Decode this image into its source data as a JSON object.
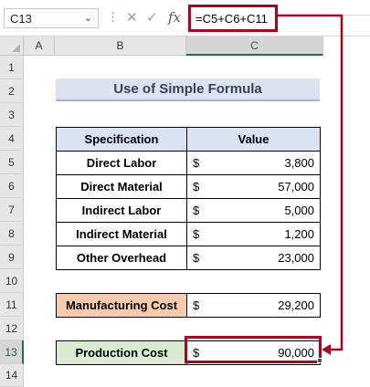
{
  "formula_bar": {
    "name_box": "C13",
    "formula": "=C5+C6+C11",
    "cancel_icon": "x-icon",
    "enter_icon": "check-icon",
    "function_icon": "fx"
  },
  "columns": [
    "A",
    "B",
    "C"
  ],
  "rows": [
    "1",
    "2",
    "3",
    "4",
    "5",
    "6",
    "7",
    "8",
    "9",
    "10",
    "11",
    "12",
    "13",
    "14"
  ],
  "title": "Use of Simple Formula",
  "table": {
    "header_spec": "Specification",
    "header_value": "Value",
    "rows": [
      {
        "label": "Direct Labor",
        "currency": "$",
        "value": "3,800"
      },
      {
        "label": "Direct Material",
        "currency": "$",
        "value": "57,000"
      },
      {
        "label": "Indirect Labor",
        "currency": "$",
        "value": "5,000"
      },
      {
        "label": "Indirect Material",
        "currency": "$",
        "value": "1,200"
      },
      {
        "label": "Other Overhead",
        "currency": "$",
        "value": "23,000"
      }
    ]
  },
  "manufacturing": {
    "label": "Manufacturing Cost",
    "currency": "$",
    "value": "29,200"
  },
  "production": {
    "label": "Production Cost",
    "currency": "$",
    "value": "90,000"
  },
  "colors": {
    "highlight_red": "#b00020",
    "title_fill": "#dbe3f1",
    "header_fill": "#d9e3f3",
    "manufacturing_fill": "#f8cbad",
    "production_fill": "#d9ead3",
    "excel_green": "#217346"
  }
}
